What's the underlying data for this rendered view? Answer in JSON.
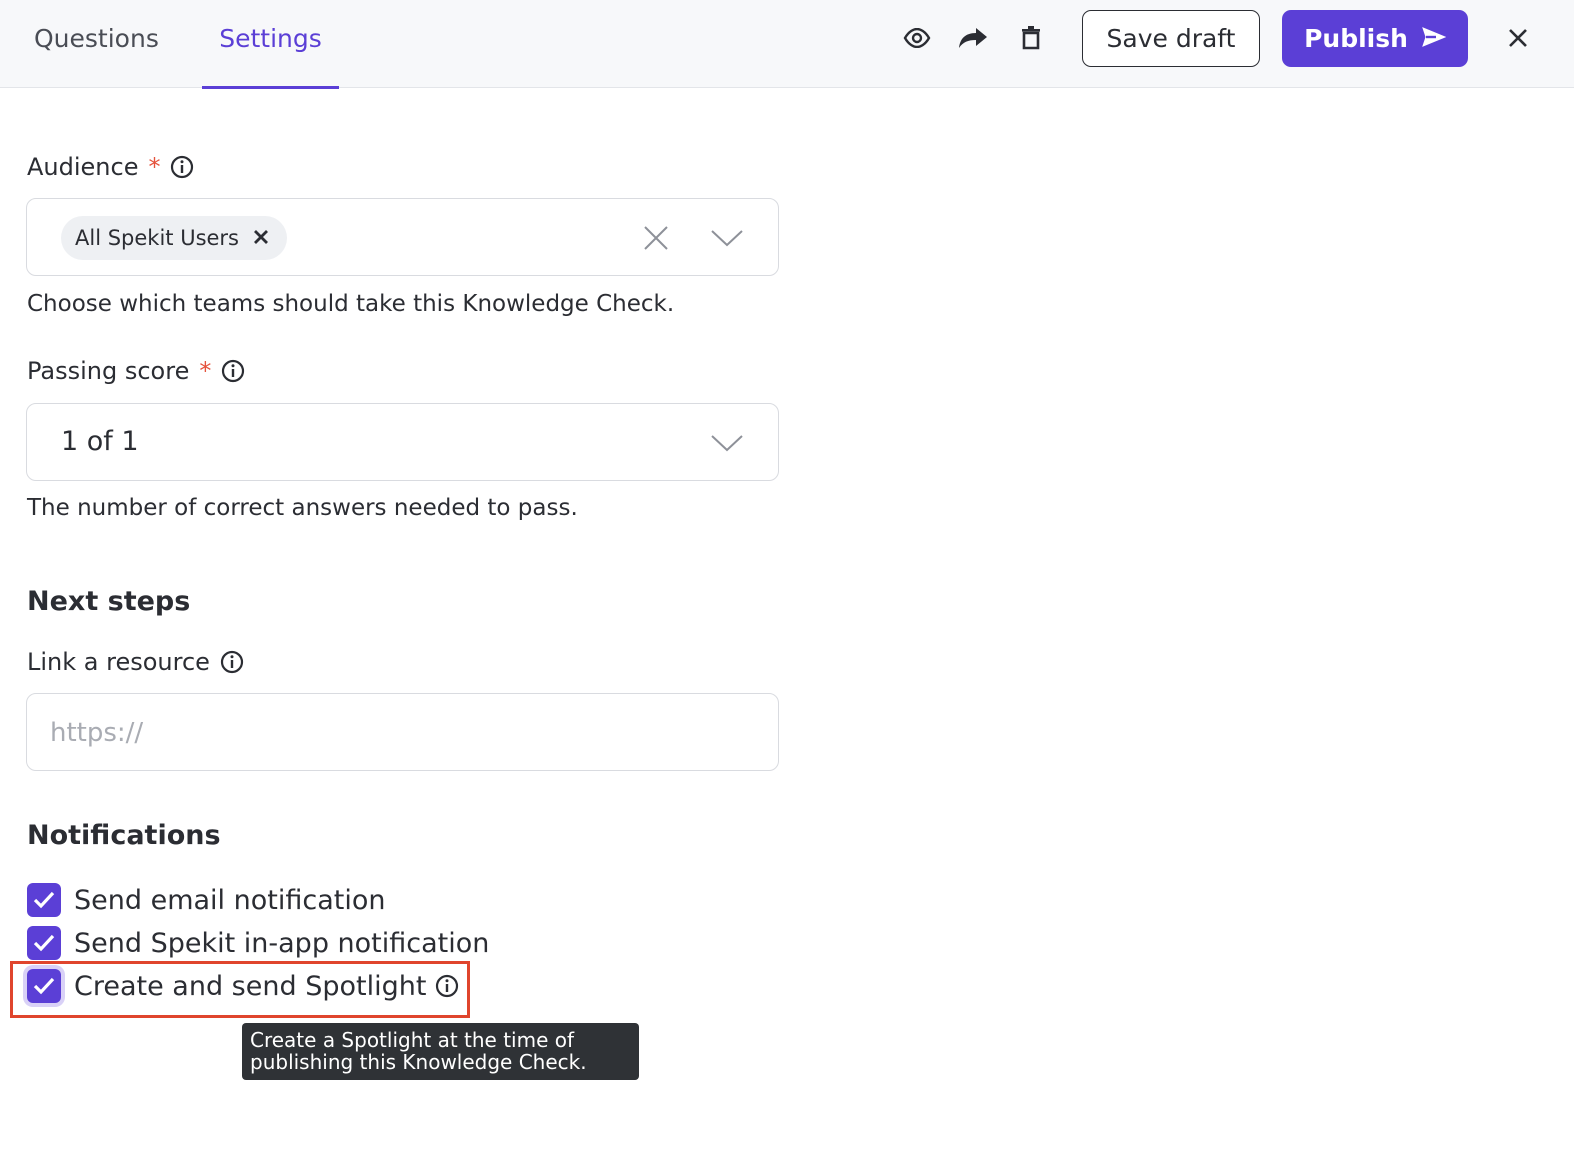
{
  "tabs": [
    {
      "label": "Questions",
      "active": false
    },
    {
      "label": "Settings",
      "active": true
    }
  ],
  "toolbar": {
    "preview_icon": "eye-icon",
    "share_icon": "share-arrow-icon",
    "delete_icon": "trash-icon",
    "save_draft_label": "Save draft",
    "publish_label": "Publish",
    "publish_icon": "send-icon",
    "close_icon": "close-icon"
  },
  "audience": {
    "label": "Audience",
    "required_mark": "*",
    "selected_chip": "All Spekit Users",
    "helper": "Choose which teams should take this Knowledge Check."
  },
  "passing_score": {
    "label": "Passing score",
    "required_mark": "*",
    "value": "1 of 1",
    "helper": "The number of correct answers needed to pass."
  },
  "next_steps": {
    "title": "Next steps",
    "link_label": "Link a resource",
    "link_placeholder": "https://"
  },
  "notifications": {
    "title": "Notifications",
    "items": [
      {
        "label": "Send email notification",
        "checked": true
      },
      {
        "label": "Send Spekit in-app notification",
        "checked": true
      },
      {
        "label": "Create and send Spotlight",
        "checked": true
      }
    ],
    "tooltip": "Create a Spotlight at the time of publishing this Knowledge Check."
  },
  "colors": {
    "accent": "#5b3fd6",
    "required": "#e5533d",
    "highlight": "#e0452d",
    "tooltip_bg": "#2f3236"
  }
}
